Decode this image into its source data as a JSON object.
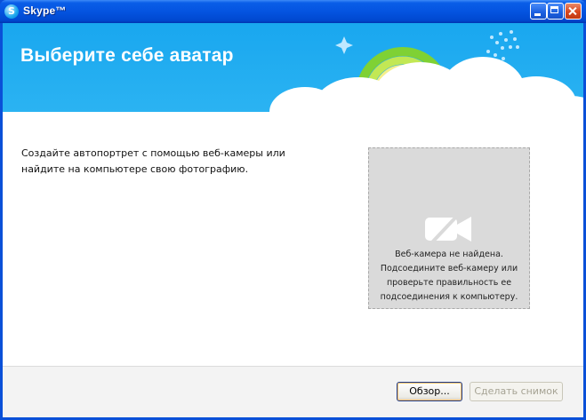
{
  "window": {
    "title": "Skype™",
    "icon": "skype-icon",
    "controls": [
      "minimize-icon",
      "maximize-icon",
      "close-icon"
    ]
  },
  "banner": {
    "heading": "Выберите себе аватар"
  },
  "main": {
    "description_line1": "Создайте автопортрет с помощью веб-камеры или",
    "description_line2": "найдите на компьютере свою фотографию."
  },
  "webcam": {
    "icon": "webcam-off-icon",
    "message": "Веб-камера не найдена.\nПодсоедините веб-камеру или\nпроверьте правильность ее\nподсоединения к компьютеру."
  },
  "footer": {
    "browse_label": "Обзор...",
    "snapshot_label": "Сделать снимок"
  },
  "colors": {
    "banner": "#1ea9ef",
    "titlebar": "#0454e0",
    "webcam_box": "#dadada"
  }
}
